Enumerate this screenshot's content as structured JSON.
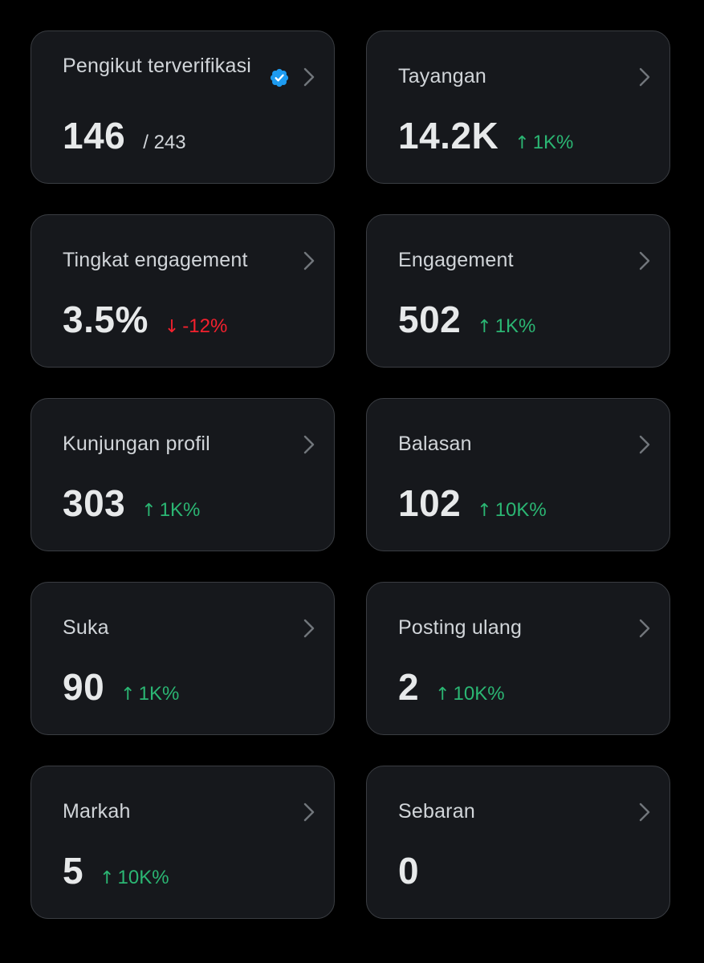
{
  "colors": {
    "background": "#000000",
    "card_background": "#16181c",
    "card_border": "#3a3d42",
    "positive": "#2bb673",
    "negative": "#f4212e",
    "verified_badge": "#1d9bf0"
  },
  "cards": [
    {
      "title": "Pengikut terverifikasi",
      "value": "146",
      "denominator": "/ 243",
      "icon": "verified-badge-icon"
    },
    {
      "title": "Tayangan",
      "value": "14.2K",
      "delta": "1K%",
      "direction": "up"
    },
    {
      "title": "Tingkat engagement",
      "value": "3.5%",
      "delta": "-12%",
      "direction": "down"
    },
    {
      "title": "Engagement",
      "value": "502",
      "delta": "1K%",
      "direction": "up"
    },
    {
      "title": "Kunjungan profil",
      "value": "303",
      "delta": "1K%",
      "direction": "up"
    },
    {
      "title": "Balasan",
      "value": "102",
      "delta": "10K%",
      "direction": "up"
    },
    {
      "title": "Suka",
      "value": "90",
      "delta": "1K%",
      "direction": "up"
    },
    {
      "title": "Posting ulang",
      "value": "2",
      "delta": "10K%",
      "direction": "up"
    },
    {
      "title": "Markah",
      "value": "5",
      "delta": "10K%",
      "direction": "up"
    },
    {
      "title": "Sebaran",
      "value": "0"
    }
  ],
  "icons": {
    "chevron": "chevron-right-icon",
    "up": "arrow-up-icon",
    "down": "arrow-down-icon"
  },
  "arrows": {
    "up": "↑",
    "down": "↓"
  }
}
